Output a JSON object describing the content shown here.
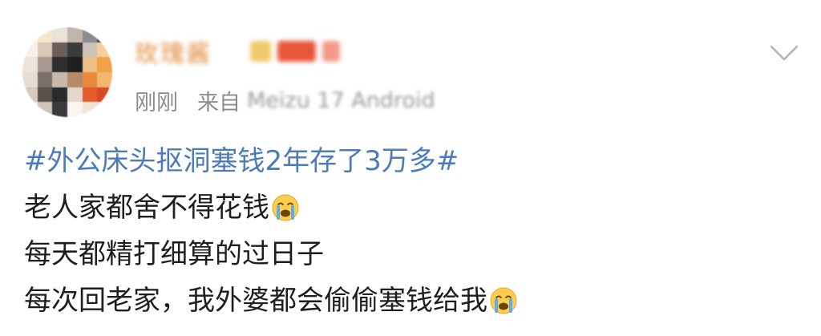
{
  "post": {
    "username": "玫瑰酱",
    "time": "刚刚",
    "source_prefix": "来自",
    "device": "Meizu 17 Android",
    "lines": [
      {
        "text": "#外公床头抠洞塞钱2年存了3万多#",
        "type": "hashtag",
        "emoji": ""
      },
      {
        "text": "老人家都舍不得花钱",
        "type": "text",
        "emoji": "crying-face-icon"
      },
      {
        "text": "每天都精打细算的过日子",
        "type": "text",
        "emoji": ""
      },
      {
        "text": "每次回老家，我外婆都会偷偷塞钱给我",
        "type": "text",
        "emoji": "crying-face-icon"
      }
    ]
  },
  "colors": {
    "hashtag": "#4b7bb8",
    "text": "#1e1e1e",
    "meta": "#8c8c8c",
    "username": "#e08a3a"
  },
  "icons": {
    "expand": "chevron-down-icon",
    "emoji": "crying-face-icon"
  }
}
